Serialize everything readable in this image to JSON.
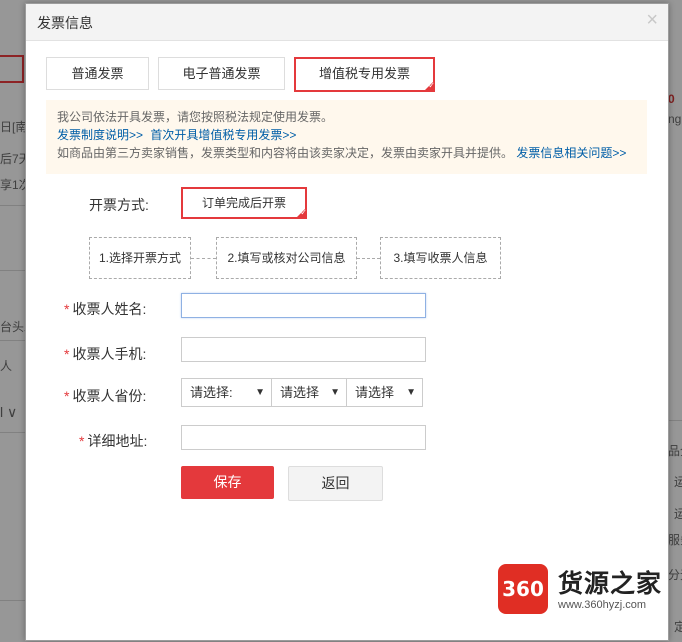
{
  "background": {
    "fragments": [
      "日[南",
      "后7天",
      "享1次",
      "台头发",
      "人",
      "l ∨",
      "0",
      "ng",
      "品全",
      "运",
      "运",
      "服务",
      "分无",
      "定"
    ]
  },
  "dialog": {
    "title": "发票信息",
    "close": "×",
    "tabs": [
      {
        "label": "普通发票",
        "active": false
      },
      {
        "label": "电子普通发票",
        "active": false
      },
      {
        "label": "增值税专用发票",
        "active": true
      }
    ],
    "notice": {
      "line1": "我公司依法开具发票，请您按照税法规定使用发票。",
      "link1": "发票制度说明>>",
      "link2": "首次开具增值税专用发票>>",
      "line3": "如商品由第三方卖家销售，发票类型和内容将由该卖家决定，发票由卖家开具并提供。",
      "link3": "发票信息相关问题>>"
    },
    "method_label": "开票方式:",
    "method_value": "订单完成后开票",
    "steps": [
      "1.选择开票方式",
      "2.填写或核对公司信息",
      "3.填写收票人信息"
    ],
    "required_mark": "*",
    "fields": {
      "name_label": "收票人姓名:",
      "phone_label": "收票人手机:",
      "province_label": "收票人省份:",
      "address_label": "详细地址:"
    },
    "province_selects": [
      "请选择:",
      "请选择",
      "请选择"
    ],
    "save_label": "保存",
    "back_label": "返回"
  },
  "watermark": {
    "badge": "360",
    "name": "货源之家",
    "url": "www.360hyzj.com"
  },
  "colors": {
    "accent": "#e4393c",
    "link": "#005ea7",
    "notice_bg": "#fff8ed"
  }
}
